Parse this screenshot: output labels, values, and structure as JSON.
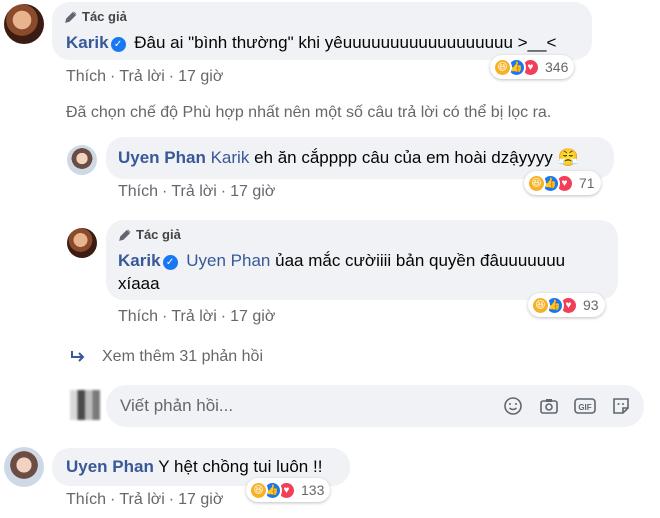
{
  "comment1": {
    "author_badge": "Tác giả",
    "author": "Karik",
    "text": "Đâu ai \"bình thường\" khi yêuuuuuuuuuuuuuuuuuu >__<",
    "like": "Thích",
    "reply": "Trả lời",
    "time": "17 giờ",
    "reaction_count": "346"
  },
  "filter_notice": "Đã chọn chế độ Phù hợp nhất nên một số câu trả lời có thể bị lọc ra.",
  "reply1": {
    "author": "Uyen Phan",
    "tag": "Karik",
    "text": "eh ăn cắpppp câu của em hoài dzậyyyy",
    "emoji": "😤",
    "like": "Thích",
    "reply": "Trả lời",
    "time": "17 giờ",
    "reaction_count": "71"
  },
  "reply2": {
    "author_badge": "Tác giả",
    "author": "Karik",
    "tag": "Uyen Phan",
    "text_line1": "ủaa mắc cườiiii bản quyền đâuuuuuuu",
    "text_line2": "xíaaa",
    "like": "Thích",
    "reply": "Trả lời",
    "time": "17 giờ",
    "reaction_count": "93"
  },
  "more_replies": "Xem thêm 31 phản hồi",
  "composer": {
    "placeholder": "Viết phản hồi...",
    "icons": [
      "emoji-icon",
      "camera-icon",
      "gif-icon",
      "sticker-icon"
    ]
  },
  "comment2": {
    "author": "Uyen Phan",
    "text": "Y hệt chồng tui luôn !!",
    "like": "Thích",
    "reply": "Trả lời",
    "time": "17 giờ",
    "reaction_count": "133"
  },
  "colors": {
    "name": "#385898",
    "bubble": "#f0f2f5",
    "meta": "#65676b",
    "verified": "#1877f2"
  }
}
